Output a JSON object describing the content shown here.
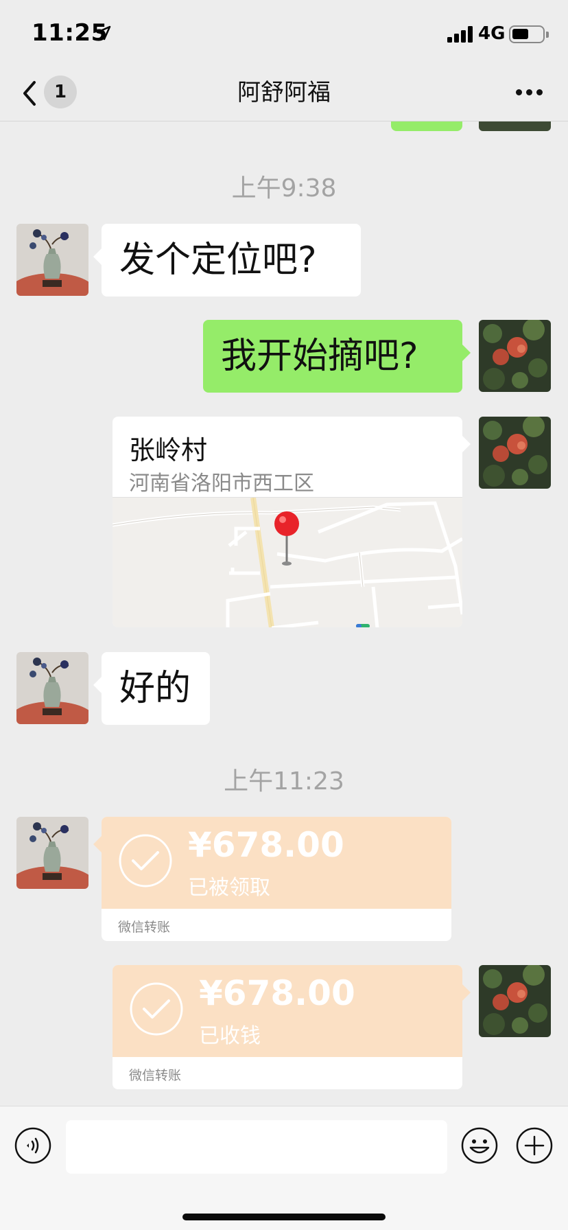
{
  "status_bar": {
    "time": "11:25",
    "network": "4G",
    "signal_bars": 4,
    "battery_level": 0.55,
    "icons": [
      "location-arrow-icon",
      "signal-icon",
      "battery-icon"
    ]
  },
  "nav": {
    "back_icon": "chevron-left-icon",
    "unread_count": "1",
    "title": "阿舒阿福",
    "more_icon": "more-dots-icon"
  },
  "messages": [
    {
      "type": "timestamp",
      "text": "上午9:38"
    },
    {
      "type": "text",
      "from": "other",
      "text": "发个定位吧?"
    },
    {
      "type": "text",
      "from": "self",
      "text": "我开始摘吧?"
    },
    {
      "type": "location",
      "from": "self",
      "name": "张岭村",
      "address": "河南省洛阳市西工区"
    },
    {
      "type": "text",
      "from": "other",
      "text": "好的"
    },
    {
      "type": "timestamp",
      "text": "上午11:23"
    },
    {
      "type": "transfer",
      "from": "other",
      "amount": "¥678.00",
      "status": "已被领取",
      "label": "微信转账"
    },
    {
      "type": "transfer",
      "from": "self",
      "amount": "¥678.00",
      "status": "已收钱",
      "label": "微信转账"
    }
  ],
  "input_bar": {
    "voice_icon": "voice-icon",
    "text_value": "",
    "emoji_icon": "emoji-icon",
    "plus_icon": "plus-icon"
  },
  "colors": {
    "background": "#ededed",
    "self_bubble": "#95ec69",
    "other_bubble": "#ffffff",
    "transfer_bg": "#fbe0c4",
    "timestamp": "#a3a3a3"
  }
}
